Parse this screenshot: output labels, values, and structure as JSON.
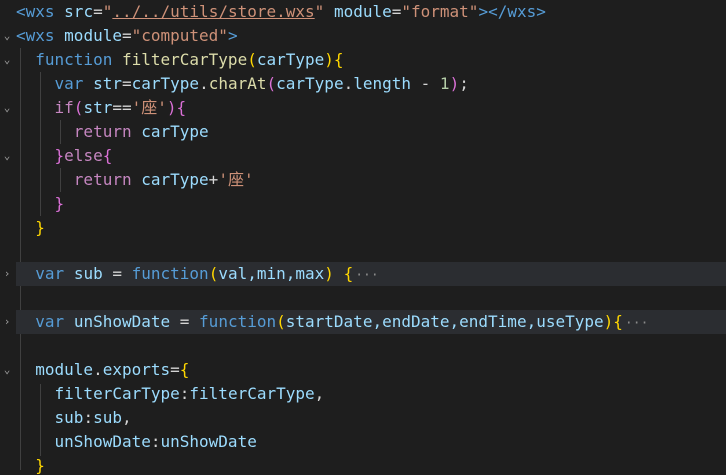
{
  "editor": {
    "language": "wxml",
    "lines": [
      {
        "open_tag": "<wxs",
        "attr1": "src",
        "eq1": "=",
        "q1": "\"",
        "src_value": "../../utils/store.wxs",
        "q2": "\"",
        "attr2": "module",
        "eq2": "=",
        "module_value": "\"format\"",
        "close": "></wxs>"
      },
      {
        "open_tag": "<wxs",
        "attr": "module",
        "eq": "=",
        "value": "\"computed\"",
        "close": ">"
      },
      {
        "kw": "function",
        "name": "filterCarType",
        "paren_open": "(",
        "param": "carType",
        "paren_close": ")",
        "brace": "{"
      },
      {
        "kw": "var",
        "var": "str",
        "eq": "=",
        "obj": "carType",
        "dot1": ".",
        "method": "charAt",
        "p1": "(",
        "arg_obj": "carType",
        "dot2": ".",
        "prop": "length",
        "minus": " - ",
        "num": "1",
        "p2": ")",
        "semi": ";"
      },
      {
        "kw": "if",
        "p1": "(",
        "var": "str",
        "op": "==",
        "str": "'座'",
        "p2": ")",
        "brace": "{"
      },
      {
        "kw": "return",
        "value": "carType"
      },
      {
        "brace": "}",
        "kw": "else",
        "brace2": "{"
      },
      {
        "kw": "return",
        "value": "carType",
        "op": "+",
        "str": "'座'"
      },
      {
        "brace": "}"
      },
      {
        "brace": "}"
      },
      {
        "kw": "var",
        "var": "sub",
        "eq": " = ",
        "fn": "function",
        "p1": "(",
        "params": "val,min,max",
        "p2": ")",
        "brace": "{",
        "ellipsis": "···"
      },
      {
        "kw": "var",
        "var": "unShowDate",
        "eq": " = ",
        "fn": "function",
        "p1": "(",
        "params": "startDate,endDate,endTime,useType",
        "p2": ")",
        "brace": "{",
        "ellipsis": "···"
      },
      {
        "obj": "module",
        "dot": ".",
        "prop": "exports",
        "eq": "=",
        "brace": "{"
      },
      {
        "key": "filterCarType",
        "colon": ":",
        "value": "filterCarType",
        "comma": ","
      },
      {
        "key": "sub",
        "colon": ":",
        "value": "sub",
        "comma": ","
      },
      {
        "key": "unShowDate",
        "colon": ":",
        "value": "unShowDate"
      },
      {
        "brace": "}"
      }
    ],
    "fold_icons": {
      "expanded": "⌄",
      "collapsed": "›"
    }
  }
}
